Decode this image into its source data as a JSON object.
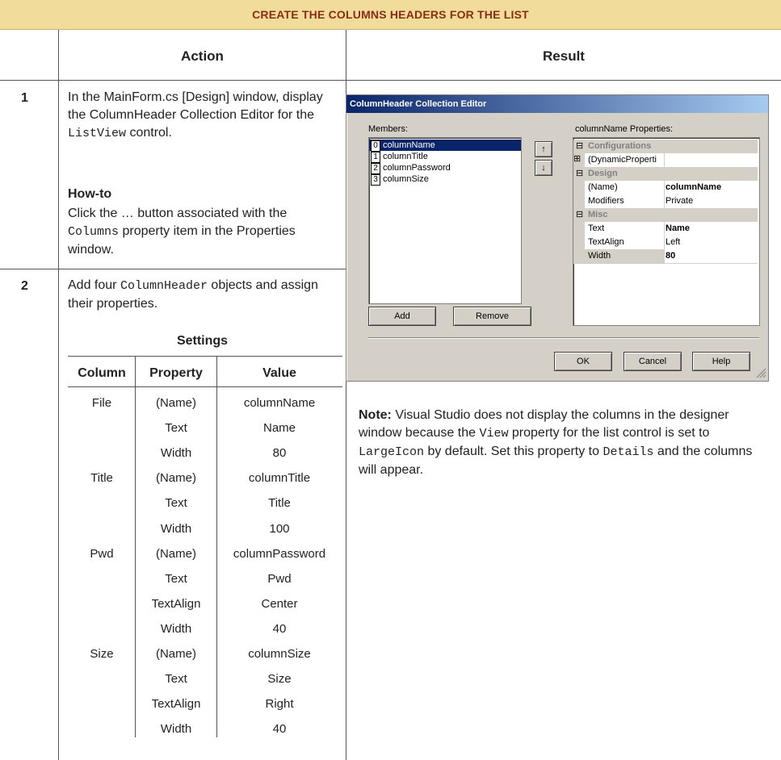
{
  "banner": {
    "title": "Create the columns headers for the list"
  },
  "headers": {
    "action": "Action",
    "result": "Result"
  },
  "steps": [
    {
      "number": "1",
      "text_a": "In the MainForm.cs [Design] window, display the ColumnHeader Collection Editor for the ",
      "code_a": "ListView",
      "text_b": " control.",
      "howto_label": "How-to",
      "howto_a": "Click the … button associated with the ",
      "howto_code": "Columns",
      "howto_b": " property item in the Properties window."
    },
    {
      "number": "2",
      "text_a": "Add four ",
      "code_a": "ColumnHeader",
      "text_b": " objects and assign their properties."
    }
  ],
  "settings": {
    "title": "Settings",
    "columns": [
      "Column",
      "Property",
      "Value"
    ],
    "rows": [
      [
        "File",
        "(Name)",
        "columnName"
      ],
      [
        "",
        "Text",
        "Name"
      ],
      [
        "",
        "Width",
        "80"
      ],
      [
        "Title",
        "(Name)",
        "columnTitle"
      ],
      [
        "",
        "Text",
        "Title"
      ],
      [
        "",
        "Width",
        "100"
      ],
      [
        "Pwd",
        "(Name)",
        "columnPassword"
      ],
      [
        "",
        "Text",
        "Pwd"
      ],
      [
        "",
        "TextAlign",
        "Center"
      ],
      [
        "",
        "Width",
        "40"
      ],
      [
        "Size",
        "(Name)",
        "columnSize"
      ],
      [
        "",
        "Text",
        "Size"
      ],
      [
        "",
        "TextAlign",
        "Right"
      ],
      [
        "",
        "Width",
        "40"
      ]
    ]
  },
  "dialog": {
    "title": "ColumnHeader Collection Editor",
    "members_label": "Members:",
    "members": [
      {
        "index": "0",
        "name": "columnName"
      },
      {
        "index": "1",
        "name": "columnTitle"
      },
      {
        "index": "2",
        "name": "columnPassword"
      },
      {
        "index": "3",
        "name": "columnSize"
      }
    ],
    "properties_label": "columnName Properties:",
    "properties": [
      {
        "type": "cat",
        "sign": "⊟",
        "label": "Configurations"
      },
      {
        "type": "row",
        "sign": "⊞",
        "name": "(DynamicProperti",
        "value": ""
      },
      {
        "type": "cat",
        "sign": "⊟",
        "label": "Design"
      },
      {
        "type": "row",
        "name": "(Name)",
        "value": "columnName",
        "bold": true
      },
      {
        "type": "row",
        "name": "Modifiers",
        "value": "Private"
      },
      {
        "type": "cat",
        "sign": "⊟",
        "label": "Misc"
      },
      {
        "type": "row",
        "name": "Text",
        "value": "Name",
        "bold": true
      },
      {
        "type": "row",
        "name": "TextAlign",
        "value": "Left"
      },
      {
        "type": "row",
        "name": "Width",
        "value": "80",
        "bold": true,
        "selected": true
      }
    ],
    "buttons": {
      "add": "Add",
      "remove": "Remove",
      "ok": "OK",
      "cancel": "Cancel",
      "help": "Help",
      "up": "↑",
      "down": "↓"
    }
  },
  "note": {
    "label": "Note:",
    "text_a": " Visual Studio does not display the columns in the designer window because the ",
    "code_a": "View",
    "text_b": " property for the list control is set to ",
    "code_b": "LargeIcon",
    "text_c": " by default. Set this property to ",
    "code_c": "Details",
    "text_d": " and the columns will appear."
  },
  "colors": {
    "banner_bg": "#f2dc9c",
    "banner_text": "#8a2e13",
    "dialog_bg": "#d4d0c8",
    "titlebar": "#0a246a",
    "selection": "#0a246a"
  }
}
